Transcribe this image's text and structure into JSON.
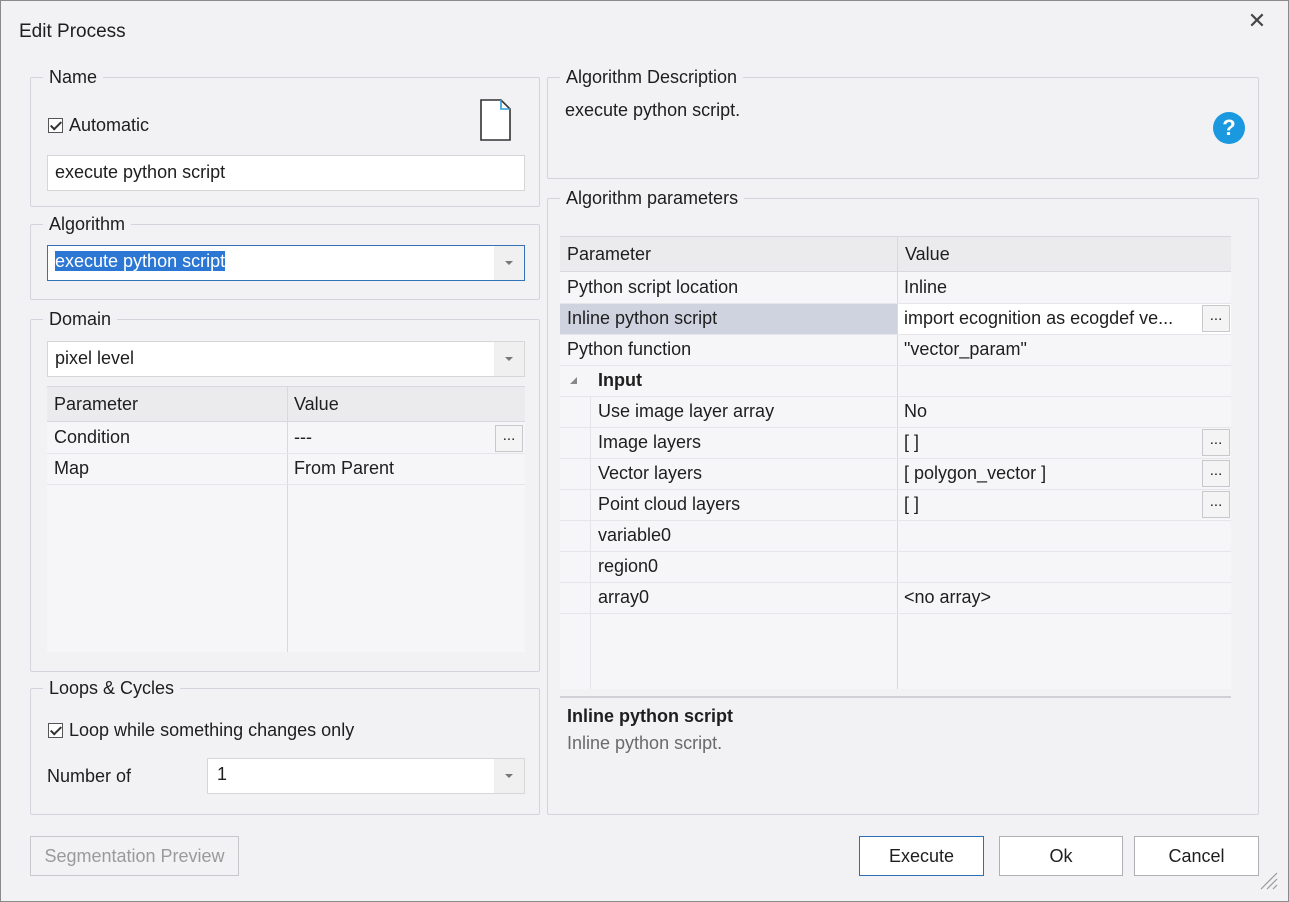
{
  "window": {
    "title": "Edit Process"
  },
  "name_group": {
    "legend": "Name",
    "automatic_label": "Automatic",
    "name_value": "execute python script"
  },
  "algorithm_group": {
    "legend": "Algorithm",
    "selected": "execute python script"
  },
  "domain_group": {
    "legend": "Domain",
    "selected": "pixel level",
    "grid": {
      "headers": [
        "Parameter",
        "Value"
      ],
      "rows": [
        {
          "param": "Condition",
          "value": "---"
        },
        {
          "param": "Map",
          "value": "From Parent"
        }
      ]
    }
  },
  "loops_group": {
    "legend": "Loops & Cycles",
    "loop_label": "Loop while something changes only",
    "number_label": "Number of",
    "number_value": "1"
  },
  "description_group": {
    "legend": "Algorithm Description",
    "text": "execute python script."
  },
  "parameters_group": {
    "legend": "Algorithm parameters",
    "headers": [
      "Parameter",
      "Value"
    ],
    "rows": [
      {
        "param": "Python script location",
        "value": "Inline"
      },
      {
        "param": "Inline python script",
        "value": "import ecognition as ecogdef ve..."
      },
      {
        "param": "Python function",
        "value": "\"vector_param\""
      }
    ],
    "input_section": "Input",
    "input_rows": [
      {
        "param": "Use image layer array",
        "value": "No"
      },
      {
        "param": "Image layers",
        "value": "[  ]"
      },
      {
        "param": "Vector layers",
        "value": "[ polygon_vector ]"
      },
      {
        "param": "Point cloud layers",
        "value": "[  ]"
      },
      {
        "param": "variable0",
        "value": ""
      },
      {
        "param": "region0",
        "value": ""
      },
      {
        "param": "array0",
        "value": "<no array>"
      }
    ],
    "dots": "...",
    "help_title": "Inline python script",
    "help_text": "Inline python script."
  },
  "buttons": {
    "segmentation_preview": "Segmentation Preview",
    "execute": "Execute",
    "ok": "Ok",
    "cancel": "Cancel"
  },
  "colors": {
    "accent": "#2c77d4",
    "help_icon": "#1a98e0",
    "selected_row": "#cfd3e0"
  }
}
